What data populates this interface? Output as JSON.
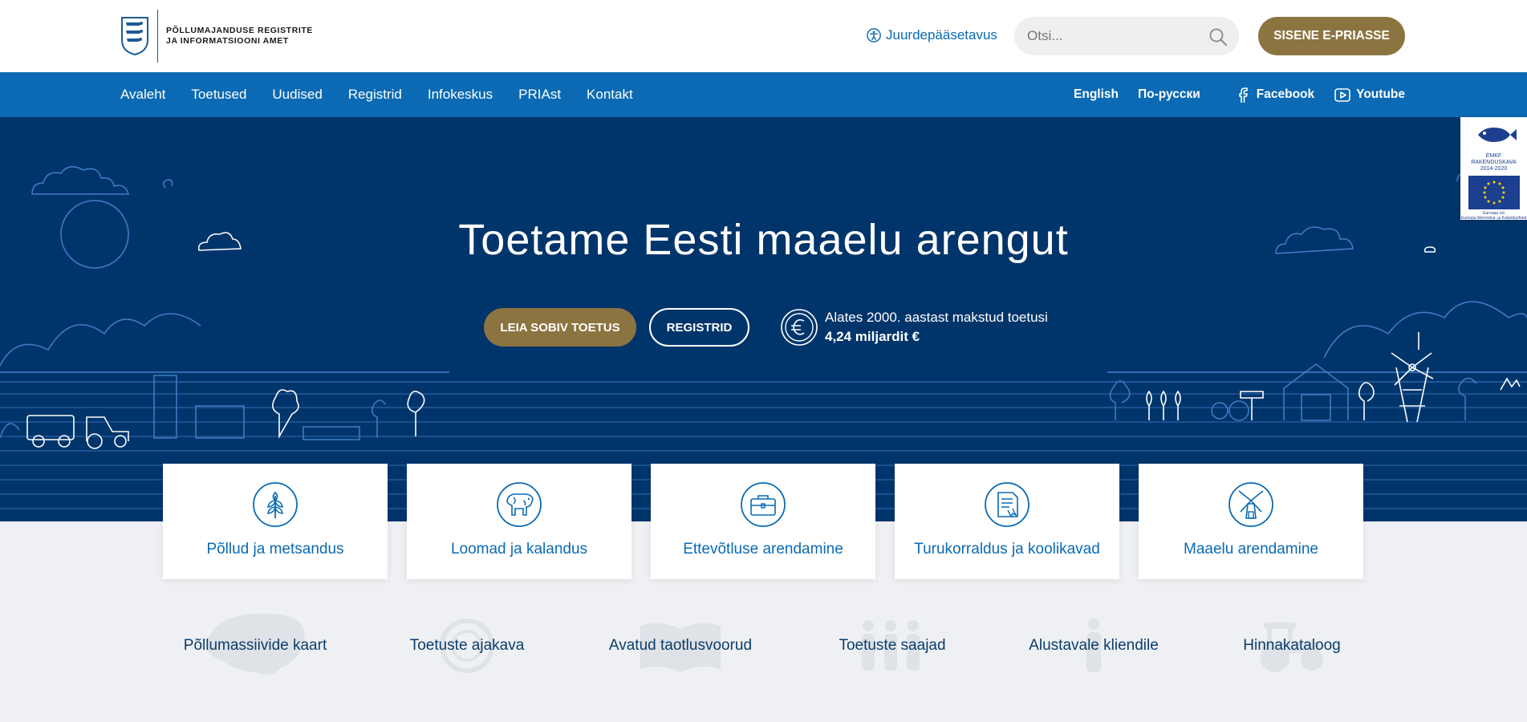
{
  "header": {
    "logo": {
      "line1": "Põllumajanduse Registrite",
      "line2": "ja Informatsiooni Amet"
    },
    "accessibility_label": "Juurdepääsetavus",
    "search": {
      "placeholder": "Otsi..."
    },
    "login_button": "SISENE E-PRIASSE"
  },
  "nav": {
    "items": [
      "Avaleht",
      "Toetused",
      "Uudised",
      "Registrid",
      "Infokeskus",
      "PRIAst",
      "Kontakt"
    ],
    "languages": [
      "English",
      "По-русски"
    ],
    "social": [
      {
        "label": "Facebook",
        "icon": "facebook-icon"
      },
      {
        "label": "Youtube",
        "icon": "youtube-icon"
      }
    ]
  },
  "hero": {
    "title": "Toetame Eesti maaelu arengut",
    "find_button": "LEIA SOBIV TOETUS",
    "registers_button": "REGISTRID",
    "paid_label": "Alates 2000. aastast makstud toetusi",
    "paid_amount": "4,24 miljardit €"
  },
  "eu_badge": {
    "program_line1": "EMKF",
    "program_line2": "RAKENDUSKAVA",
    "program_line3": "2014-2020",
    "eu_line1": "Euroopa Liit",
    "eu_line2": "Euroopa Merendus- ja Kalandusfond"
  },
  "cards": [
    {
      "label": "Põllud ja metsandus",
      "icon": "wheat-icon"
    },
    {
      "label": "Loomad ja kalandus",
      "icon": "cow-icon"
    },
    {
      "label": "Ettevõtluse arendamine",
      "icon": "briefcase-icon"
    },
    {
      "label": "Turukorraldus ja koolikavad",
      "icon": "document-icon"
    },
    {
      "label": "Maaelu arendamine",
      "icon": "windmill-icon"
    }
  ],
  "quick_links": [
    {
      "label": "Põllumassiivide kaart",
      "icon": "map-icon"
    },
    {
      "label": "Toetuste ajakava",
      "icon": "clock-icon"
    },
    {
      "label": "Avatud taotlusvoorud",
      "icon": "book-icon"
    },
    {
      "label": "Toetuste saajad",
      "icon": "people-icon"
    },
    {
      "label": "Alustavale kliendile",
      "icon": "person-icon"
    },
    {
      "label": "Hinnakataloog",
      "icon": "tractor-icon"
    }
  ],
  "colors": {
    "primary_blue": "#0b6ab3",
    "hero_blue": "#00356b",
    "gold": "#8c7440",
    "page_bg": "#eef0f3"
  }
}
